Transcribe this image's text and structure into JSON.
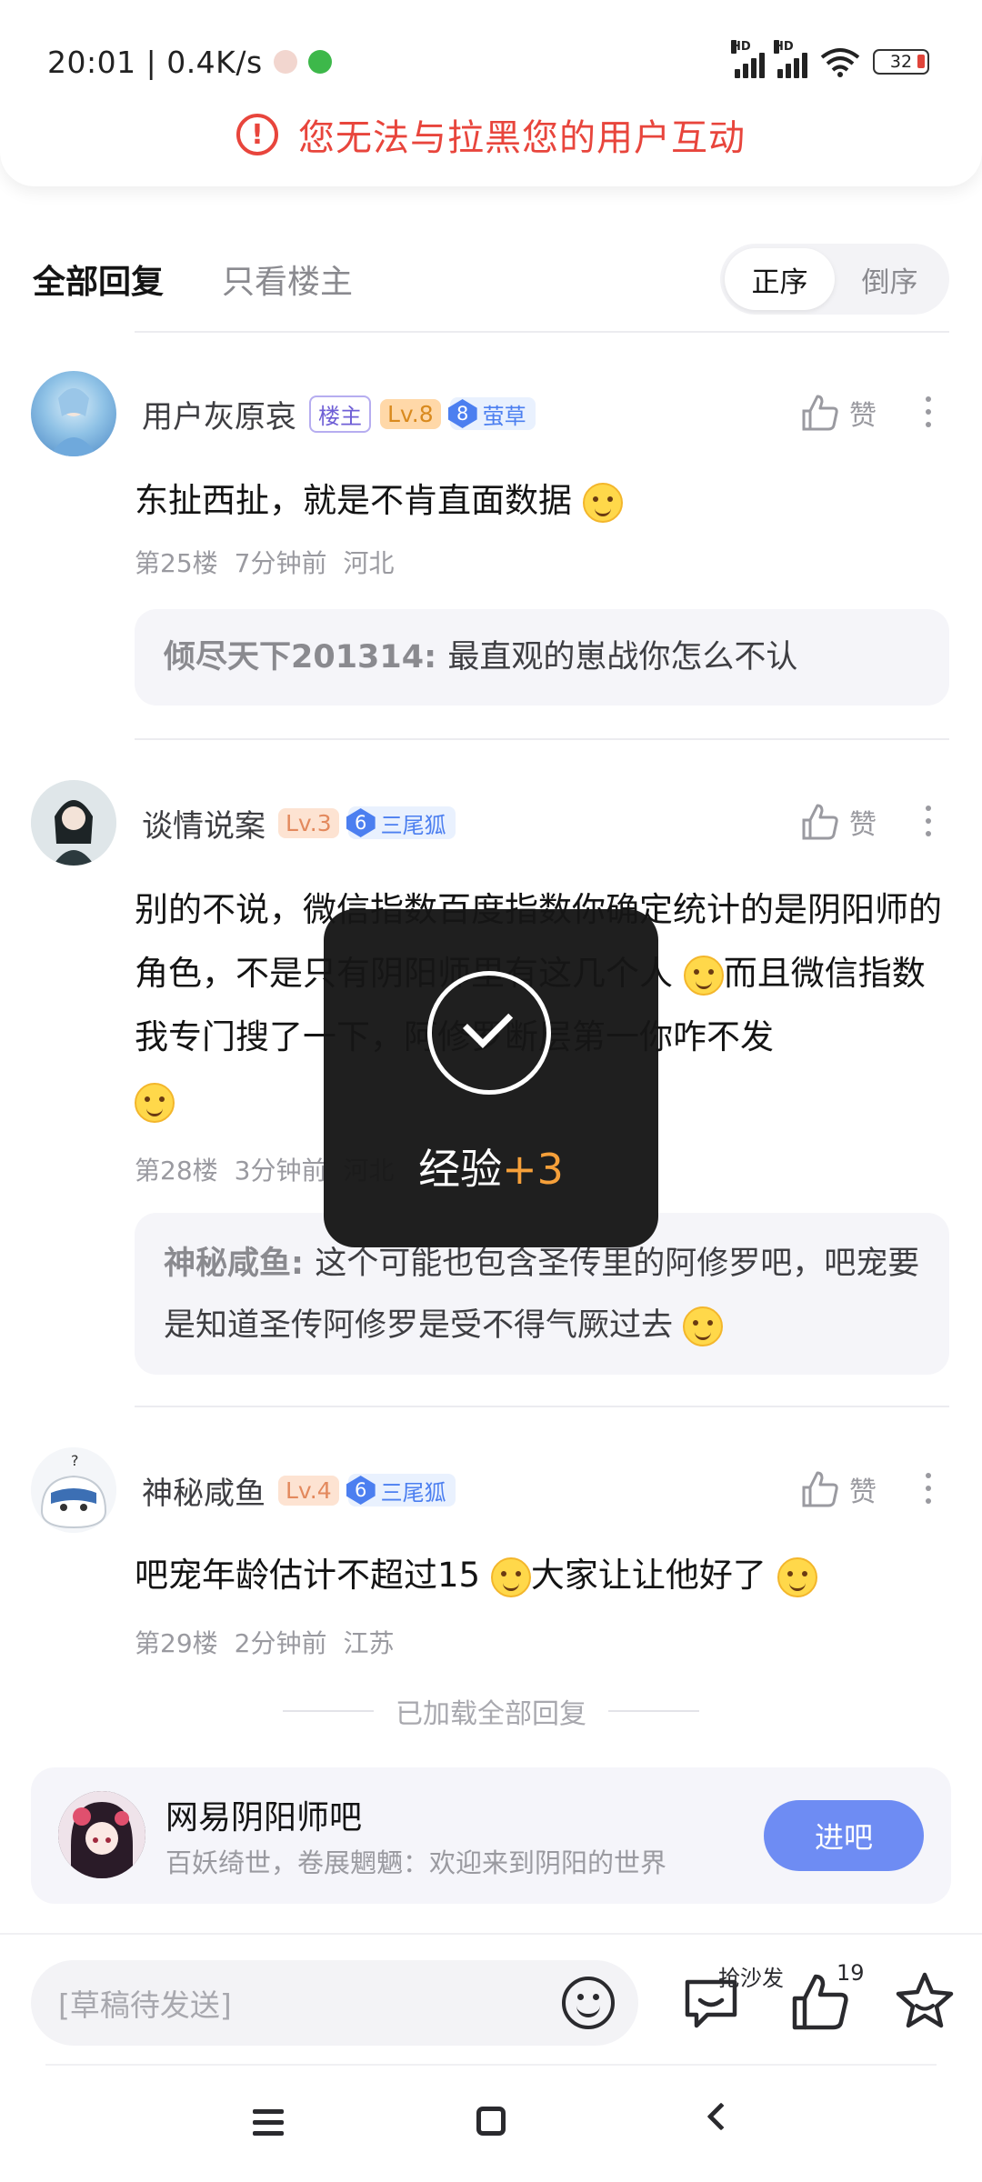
{
  "status_bar": {
    "time_speed": "20:01 | 0.4K/s",
    "battery": "32"
  },
  "error_banner": {
    "message": "您无法与拉黑您的用户互动"
  },
  "filter": {
    "tab_all": "全部回复",
    "tab_op_only": "只看楼主",
    "sort_asc": "正序",
    "sort_desc": "倒序",
    "active_sort": "正序"
  },
  "posts": [
    {
      "author": "用户灰原哀",
      "op_badge": "楼主",
      "level": "Lv.8",
      "fan_level": "8",
      "fan_title": "萤草",
      "like_label": "赞",
      "content": "东扯西扯，就是不肯直面数据",
      "floor": "第25楼",
      "time": "7分钟前",
      "location": "河北",
      "quote_author": "倾尽天下201314",
      "quote_text": "最直观的崽战你怎么不认"
    },
    {
      "author": "谈情说案",
      "level": "Lv.3",
      "fan_level": "6",
      "fan_title": "三尾狐",
      "like_label": "赞",
      "content_part1": "别的不说，微信指数百度指数你确定统计的是阴阳师的角色，不是只有阴阳师里有这几个人",
      "content_part2": "而且微信指数我专门搜了一下，阿修罗断层第一你咋不发",
      "floor": "第28楼",
      "time": "3分钟前",
      "location": "河北",
      "quote_author": "神秘咸鱼",
      "quote_text": "这个可能也包含圣传里的阿修罗吧，吧宠要是知道圣传阿修罗是受不得气厥过去"
    },
    {
      "author": "神秘咸鱼",
      "level": "Lv.4",
      "fan_level": "6",
      "fan_title": "三尾狐",
      "like_label": "赞",
      "content_part1": "吧宠年龄估计不超过15",
      "content_part2": "大家让让他好了",
      "floor": "第29楼",
      "time": "2分钟前",
      "location": "江苏"
    }
  ],
  "loaded_all": "已加载全部回复",
  "forum": {
    "name": "网易阴阳师吧",
    "slogan": "百妖绮世，卷展魍魉：欢迎来到阴阳的世界",
    "enter_label": "进吧"
  },
  "input_bar": {
    "draft_placeholder": "[草稿待发送]",
    "sofa_label": "抢沙发",
    "like_count": "19"
  },
  "toast": {
    "label": "经验",
    "value": "+3"
  },
  "colors": {
    "error": "#e8453c",
    "accent_blue": "#6e8cf3",
    "toast_orange": "#f6a03a"
  }
}
